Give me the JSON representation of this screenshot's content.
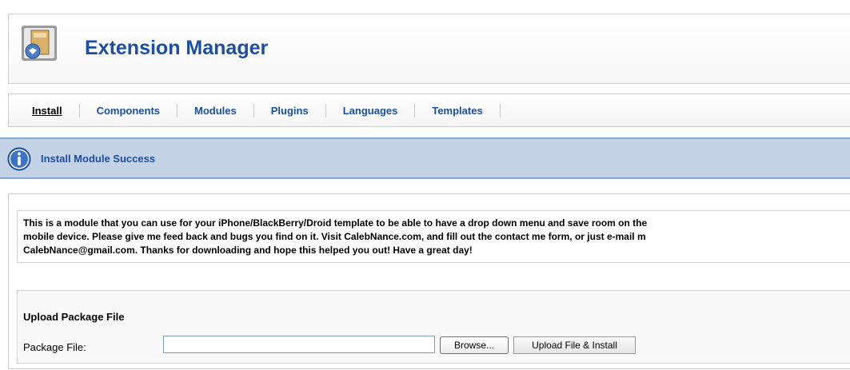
{
  "header": {
    "title": "Extension Manager",
    "icon": "extension-manager-icon"
  },
  "tabs": [
    {
      "label": "Install",
      "active": true
    },
    {
      "label": "Components"
    },
    {
      "label": "Modules"
    },
    {
      "label": "Plugins"
    },
    {
      "label": "Languages"
    },
    {
      "label": "Templates"
    }
  ],
  "message": {
    "icon": "info-icon",
    "text": "Install Module Success"
  },
  "description": {
    "line1": "This is a module that you can use for your iPhone/BlackBerry/Droid template to be able to have a drop down menu and save room on the",
    "line2": "mobile device. Please give me feed back and bugs you find on it. Visit CalebNance.com, and fill out the contact me form, or just e-mail m",
    "line3": "CalebNance@gmail.com. Thanks for downloading and hope this helped you out! Have a great day!"
  },
  "upload": {
    "legend": "Upload Package File",
    "field_label": "Package File:",
    "field_value": "",
    "browse_label": "Browse...",
    "submit_label": "Upload File & Install"
  },
  "colors": {
    "title_blue": "#1c4fa3",
    "message_bg": "#c3d2e5",
    "message_border": "#84a7db"
  }
}
